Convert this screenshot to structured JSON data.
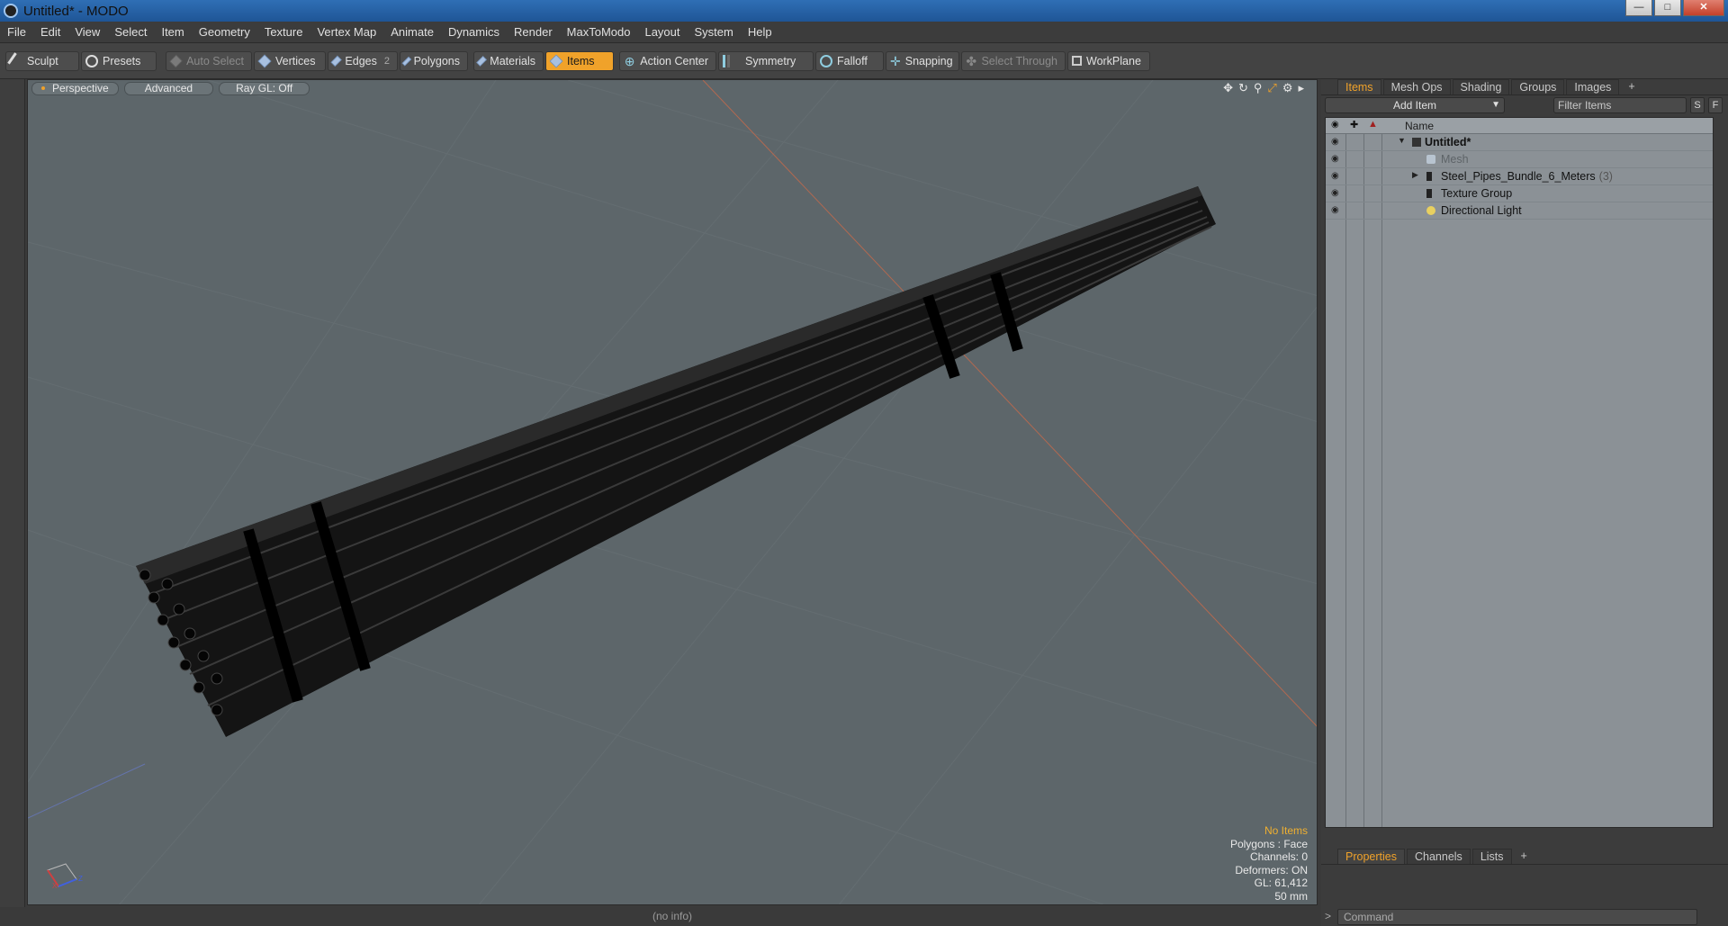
{
  "window": {
    "title": "Untitled* - MODO"
  },
  "menu": [
    "File",
    "Edit",
    "View",
    "Select",
    "Item",
    "Geometry",
    "Texture",
    "Vertex Map",
    "Animate",
    "Dynamics",
    "Render",
    "MaxToModo",
    "Layout",
    "System",
    "Help"
  ],
  "toolbar": {
    "sculpt": "Sculpt",
    "presets": "Presets",
    "auto_select": "Auto Select",
    "vertices": "Vertices",
    "edges": "Edges",
    "edges_count": "2",
    "polygons": "Polygons",
    "materials": "Materials",
    "items": "Items",
    "action_center": "Action Center",
    "symmetry": "Symmetry",
    "falloff": "Falloff",
    "snapping": "Snapping",
    "select_through": "Select Through",
    "workplane": "WorkPlane"
  },
  "viewport": {
    "tabs": [
      "Perspective",
      "Advanced",
      "Ray GL: Off"
    ],
    "info": {
      "selection": "No Items",
      "polygons": "Polygons : Face",
      "channels": "Channels: 0",
      "deformers": "Deformers: ON",
      "gl": "GL: 61,412",
      "scale": "50 mm"
    },
    "status": "(no info)"
  },
  "right_panel": {
    "tabs": [
      "Items",
      "Mesh Ops",
      "Shading",
      "Groups",
      "Images"
    ],
    "add_item": "Add Item",
    "filter_placeholder": "Filter Items",
    "btn_s": "S",
    "btn_f": "F",
    "name_header": "Name",
    "tree": [
      {
        "label": "Untitled*",
        "count": ""
      },
      {
        "label": "Mesh",
        "count": ""
      },
      {
        "label": "Steel_Pipes_Bundle_6_Meters",
        "count": "(3)"
      },
      {
        "label": "Texture Group",
        "count": ""
      },
      {
        "label": "Directional Light",
        "count": ""
      }
    ],
    "props_tabs": [
      "Properties",
      "Channels",
      "Lists"
    ],
    "command_placeholder": "Command"
  },
  "colors": {
    "accent": "#f0a22a",
    "viewport_bg": "#5d666a",
    "tree_bg": "#8b9196"
  }
}
